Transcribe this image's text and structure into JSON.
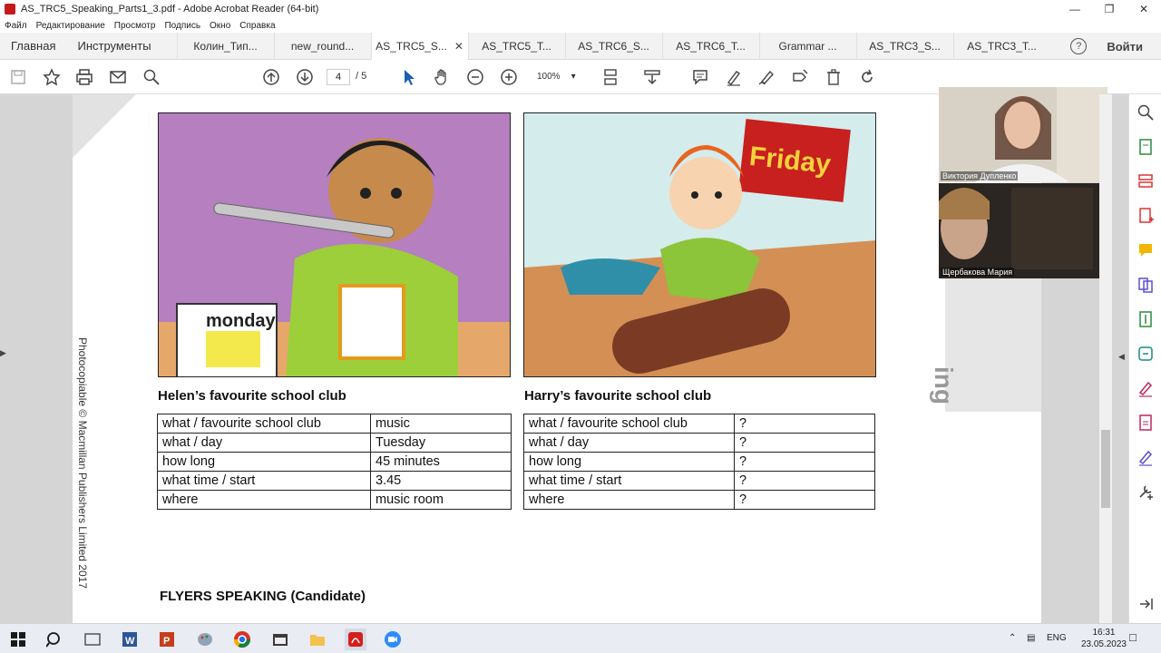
{
  "window": {
    "title": "AS_TRC5_Speaking_Parts1_3.pdf - Adobe Acrobat Reader (64-bit)"
  },
  "menu": [
    "Файл",
    "Редактирование",
    "Просмотр",
    "Подпись",
    "Окно",
    "Справка"
  ],
  "nav": {
    "home": "Главная",
    "tools": "Инструменты",
    "login": "Войти",
    "help": "?"
  },
  "tabs": [
    {
      "label": "Колин_Тип...",
      "active": false
    },
    {
      "label": "new_round...",
      "active": false
    },
    {
      "label": "AS_TRC5_S...",
      "active": true
    },
    {
      "label": "AS_TRC5_T...",
      "active": false
    },
    {
      "label": "AS_TRC6_S...",
      "active": false
    },
    {
      "label": "AS_TRC6_T...",
      "active": false
    },
    {
      "label": "Grammar ...",
      "active": false
    },
    {
      "label": "AS_TRC3_S...",
      "active": false
    },
    {
      "label": "AS_TRC3_T...",
      "active": false
    }
  ],
  "toolbar": {
    "page_current": "4",
    "page_total": "/ 5",
    "zoom": "100%"
  },
  "page": {
    "copyright": "Photocopiable © Macmillan Publishers Limited 2017",
    "side_text": "ing",
    "left_image_text": "monday",
    "right_image_text": "Friday",
    "left_caption": "Helen’s favourite school club",
    "right_caption": "Harry’s favourite school club",
    "left_table": [
      [
        "what / favourite school club",
        "music"
      ],
      [
        "what / day",
        "Tuesday"
      ],
      [
        "how long",
        "45 minutes"
      ],
      [
        "what time / start",
        "3.45"
      ],
      [
        "where",
        "music room"
      ]
    ],
    "right_table": [
      [
        "what / favourite school club",
        "?"
      ],
      [
        "what / day",
        "?"
      ],
      [
        "how long",
        "?"
      ],
      [
        "what time / start",
        "?"
      ],
      [
        "where",
        "?"
      ]
    ],
    "footer": "FLYERS SPEAKING (Candidate)"
  },
  "video": [
    {
      "name": "Виктория Дупленко"
    },
    {
      "name": "Щербакова Мария"
    }
  ],
  "tray": {
    "lang": "ENG",
    "time": "16:31",
    "date": "23.05.2023"
  }
}
